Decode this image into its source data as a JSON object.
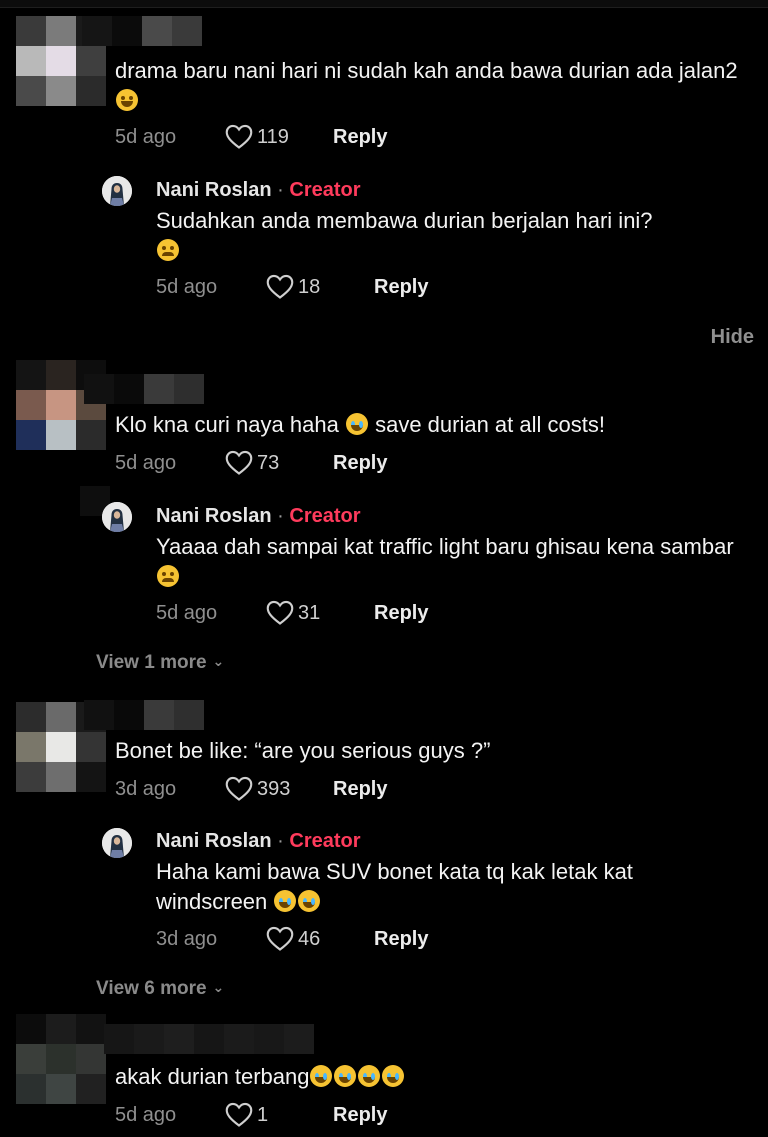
{
  "actions": {
    "hide_label": "Hide"
  },
  "comments": [
    {
      "text": "drama baru nani hari ni sudah kah anda bawa durian ada jalan2",
      "time": "5d ago",
      "likes": "119",
      "reply": "Reply",
      "reply_item": {
        "author": "Nani Roslan",
        "separator": "·",
        "badge": "Creator",
        "text": "Sudahkan anda membawa durian berjalan hari ini?",
        "time": "5d ago",
        "likes": "18",
        "reply": "Reply"
      }
    },
    {
      "text": "Klo kna curi naya haha",
      "text_after": "save durian at all costs!",
      "time": "5d ago",
      "likes": "73",
      "reply": "Reply",
      "reply_item": {
        "author": "Nani Roslan",
        "separator": "·",
        "badge": "Creator",
        "text": "Yaaaa dah sampai kat traffic light baru ghisau kena sambar",
        "time": "5d ago",
        "likes": "31",
        "reply": "Reply"
      },
      "view_more": "View 1 more"
    },
    {
      "text": "Bonet be like: “are you serious guys ?”",
      "time": "3d ago",
      "likes": "393",
      "reply": "Reply",
      "reply_item": {
        "author": "Nani Roslan",
        "separator": "·",
        "badge": "Creator",
        "text": "Haha kami bawa SUV bonet kata tq kak letak kat windscreen",
        "time": "3d ago",
        "likes": "46",
        "reply": "Reply"
      },
      "view_more": "View 6 more"
    },
    {
      "text": "akak durian terbang",
      "time": "5d ago",
      "likes": "1",
      "reply": "Reply"
    }
  ],
  "colors": {
    "background": "#000000",
    "creator_badge": "#ff3b5c",
    "muted": "#8f8f8f"
  },
  "icons": [
    "heart-outline-icon",
    "chevron-down-icon",
    "emoji-rofl",
    "emoji-tired-face",
    "emoji-tears-of-joy"
  ]
}
